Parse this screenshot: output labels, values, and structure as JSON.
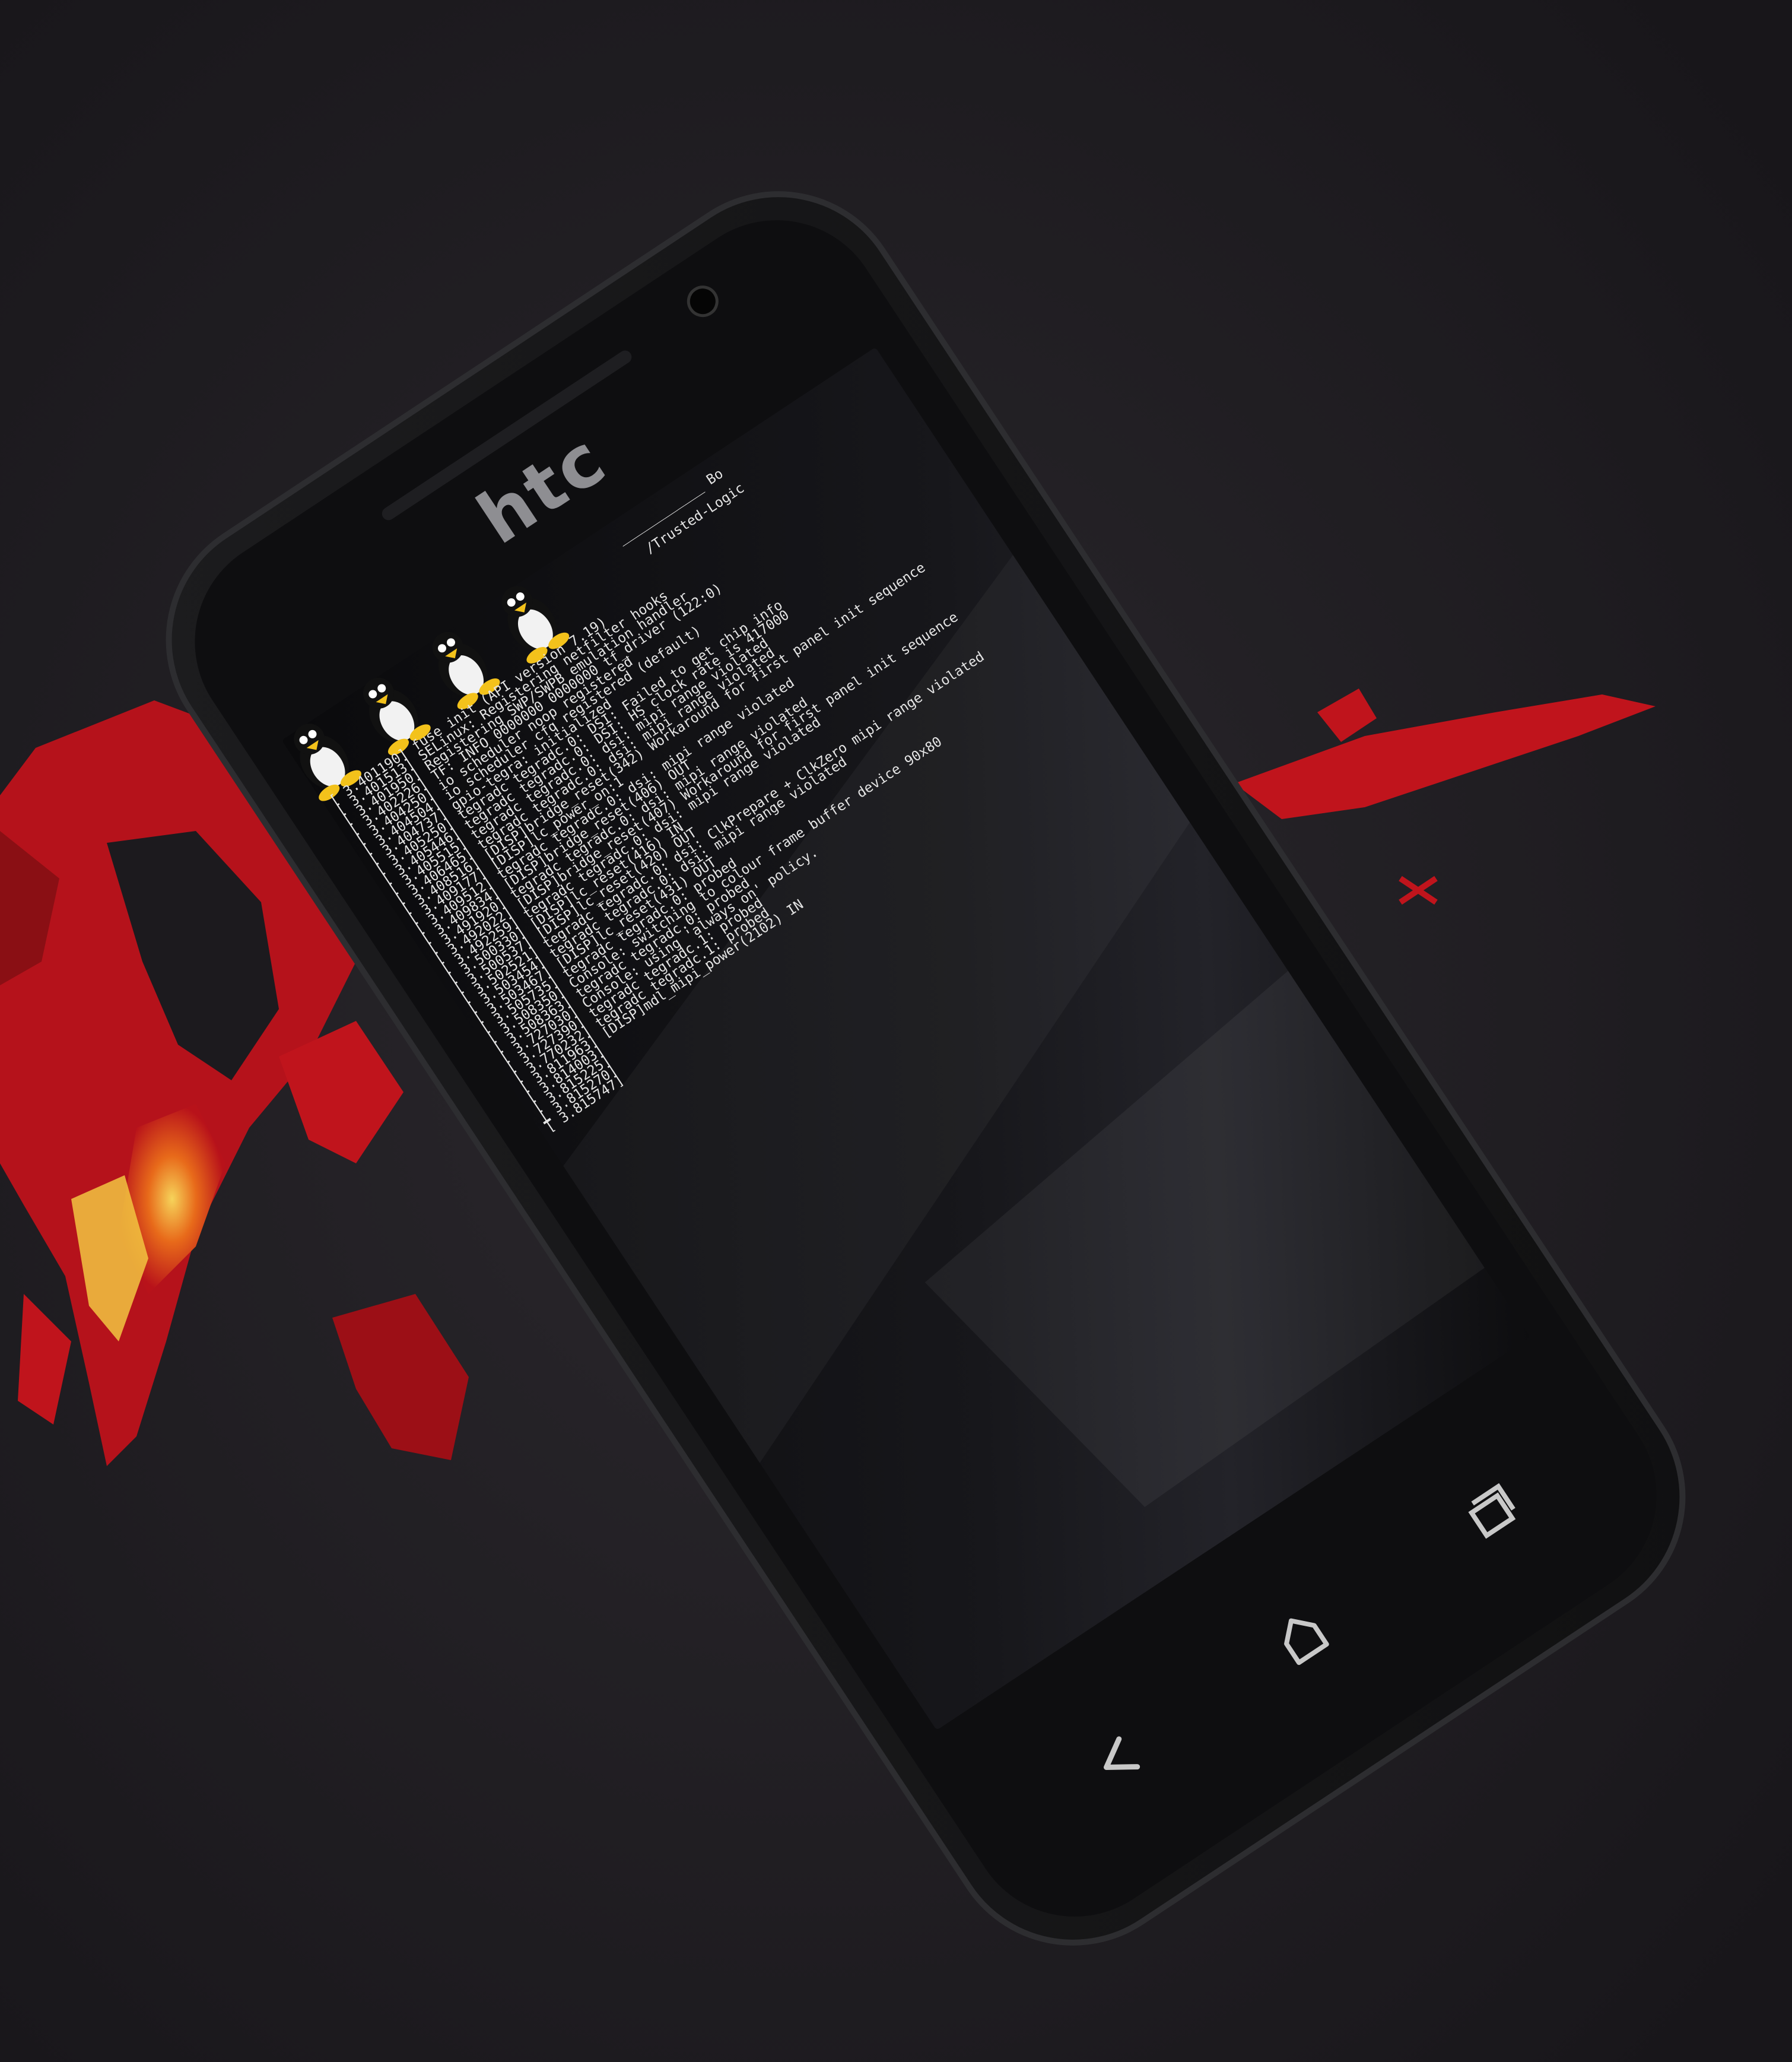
{
  "device": {
    "brand": "htc",
    "colors": {
      "body": "#141414",
      "screen": "#0b0b0d",
      "glyph": "#c8c8c8",
      "tux": "#f3c21b"
    }
  },
  "boot_log": {
    "tux_count": 4,
    "header_lines": [
      "____________ Bo",
      "/Trusted-Logic"
    ],
    "lines": [
      "3.401190] fuse init (API version 7.19)",
      "3.401513] SELinux: Registering netfilter hooks",
      "3.401950] Registering SWP/SWPB emulation handler",
      "3.402226] TF: INFO 0000000 0000000 tf_driver (122:0)",
      "3.404250] io scheduler noop registered",
      "3.404504] io scheduler cfq registered (default)",
      "3.404737] gpio-tegra: initialized",
      "3.405250] tegradc tegradc.0: DSI: Failed to get chip info",
      "3.405446] tegradc tegradc.0: DSI: HS clock rate is 417000",
      "3.405515] tegradc tegradc.0: dsi: mipi range violated",
      "3.406465] tegradc tegradc.0: dsi: mipi range violated",
      "3.408516] [DISP]bridge_reset(342) Workaround for first panel init sequence",
      "3.409177] [DISP]lc_power_on:1",
      "3.409512] tegradc tegradc.0: dsi: mipi range violated",
      "3.409834] [DISP]bridge_reset(406) OUT",
      "3.491920] tegradc tegradc.0: dsi: mipi range violated",
      "3.492022] [DISP]bridge_reset(407) Workaround for first panel init sequence",
      "3.492259] tegradc tegradc.0: dsi: mipi range violated",
      "3.500330] [DISP]lc_reset(416) IN",
      "3.500537] [DISP]lc_reset(420) OUT",
      "3.502521] tegradc tegradc.0: dsi: ClkPrepare + ClkZero mipi range violated",
      "3.503454] tegradc tegradc.0: dsi: mipi range violated",
      "3.503467] [DISP]lc_reset(431) OUT",
      "3.505735] tegradc tegradc.0: probed",
      "3.508350] Console: switching to colour frame buffer device 90x80",
      "3.508363] tegradc tegradc.0: probed",
      "3.727030] Console: using 'always on' policy.",
      "3.727390] tegradc tegradc.1: probed",
      "3.770232] tegradc tegradc.1: probed",
      "3.811963] [DISP]mdl_mipi_power(2102) IN",
      "3.814003]",
      "3.815225]",
      "3.815270]",
      "3.815747]"
    ]
  },
  "nav_buttons": {
    "back": "back-arrow-icon",
    "home": "home-icon",
    "recent": "recent-apps-icon"
  },
  "background": {
    "colors": {
      "mat": "#1e1c20",
      "red": "#c0141c",
      "dark_red": "#8a0f14",
      "yellow": "#f2c541"
    }
  }
}
